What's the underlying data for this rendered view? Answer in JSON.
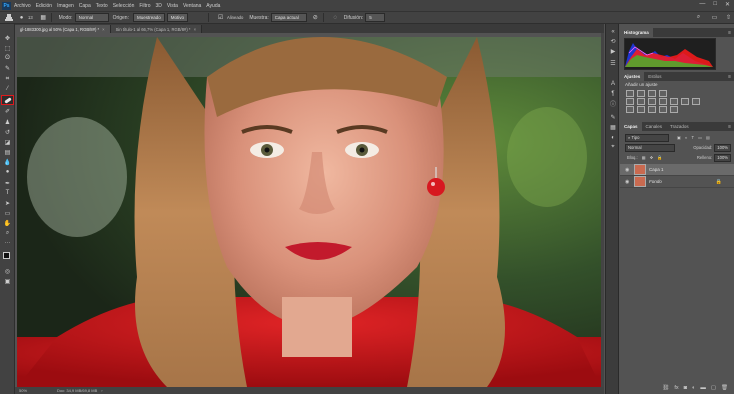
{
  "menu": {
    "logo": "Ps",
    "items": [
      "Archivo",
      "Edición",
      "Imagen",
      "Capa",
      "Texto",
      "Selección",
      "Filtro",
      "3D",
      "Vista",
      "Ventana",
      "Ayuda"
    ],
    "window_controls": [
      "—",
      "□",
      "✕"
    ]
  },
  "options": {
    "brush_size": "13",
    "modo_label": "Modo:",
    "modo_value": "Normal",
    "origen_label": "Origen:",
    "origen_value": "Muestreado",
    "motivo_label": "Motivo",
    "alineado_label": "Alineado",
    "muestra_label": "Muestra:",
    "muestra_value": "Capa actual",
    "difusion_label": "Difusión:",
    "difusion_value": "5"
  },
  "doc_tabs": [
    {
      "label": "gl-1883300.jpg al 50% (Capa 1, RGB/8#) *",
      "active": true
    },
    {
      "label": "Sin título-1 al 66,7% (Capa 1, RGB/8#) *",
      "active": false
    }
  ],
  "status": {
    "zoom": "50%",
    "doc": "Doc: 34,9 MB/69,8 MB"
  },
  "panels": {
    "histogram_tab": "Histograma",
    "adjust_tabs": [
      "Ajustes",
      "Estilos"
    ],
    "adjust_subtitle": "Añadir un ajuste",
    "layers_tabs": [
      "Capas",
      "Canales",
      "Trazados"
    ],
    "filter_label": "Tipo",
    "blend_mode": "Normal",
    "opacity_label": "Opacidad:",
    "opacity_value": "100%",
    "lock_label": "Bloq.:",
    "fill_label": "Relleno:",
    "fill_value": "100%",
    "layers": [
      {
        "name": "Capa 1",
        "selected": true
      },
      {
        "name": "Fondo",
        "selected": false
      }
    ]
  },
  "colors": {
    "accent_red": "#e0191c",
    "ui_dark": "#424242",
    "ui_mid": "#535353"
  }
}
